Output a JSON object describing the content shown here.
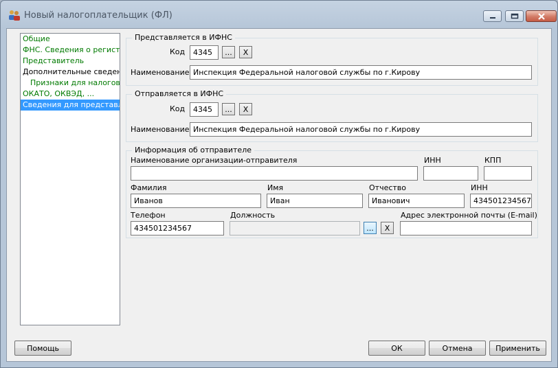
{
  "window": {
    "title": "Новый налогоплательщик (ФЛ)"
  },
  "nav": {
    "items": [
      {
        "label": "Общие"
      },
      {
        "label": "ФНС. Сведения о регистрации"
      },
      {
        "label": "Представитель"
      },
      {
        "label": "Дополнительные сведения"
      },
      {
        "label": "Признаки для налоговой"
      },
      {
        "label": "ОКАТО, ОКВЭД, ..."
      },
      {
        "label": "Сведения для представления"
      }
    ]
  },
  "presented": {
    "title": "Представляется в ИФНС",
    "code_label": "Код",
    "code_value": "4345",
    "browse_label": "...",
    "clear_label": "X",
    "name_label": "Наименование",
    "name_value": "Инспекция Федеральной налоговой службы по г.Кирову"
  },
  "sent": {
    "title": "Отправляется в ИФНС",
    "code_label": "Код",
    "code_value": "4345",
    "browse_label": "...",
    "clear_label": "X",
    "name_label": "Наименование",
    "name_value": "Инспекция Федеральной налоговой службы по г.Кирову"
  },
  "sender": {
    "title": "Информация об отправителе",
    "org_name_label": "Наименование организации-отправителя",
    "org_name_value": "",
    "org_inn_label": "ИНН",
    "org_inn_value": "",
    "kpp_label": "КПП",
    "kpp_value": "",
    "surname_label": "Фамилия",
    "surname_value": "Иванов",
    "firstname_label": "Имя",
    "firstname_value": "Иван",
    "patronymic_label": "Отчество",
    "patronymic_value": "Иванович",
    "inn_label": "ИНН",
    "inn_value": "434501234567",
    "phone_label": "Телефон",
    "phone_value": "434501234567",
    "position_label": "Должность",
    "position_value": "",
    "position_browse_label": "...",
    "position_clear_label": "X",
    "email_label": "Адрес электронной почты (E-mail)",
    "email_value": ""
  },
  "footer": {
    "help_label": "Помощь",
    "ok_label": "ОК",
    "cancel_label": "Отмена",
    "apply_label": "Применить"
  }
}
